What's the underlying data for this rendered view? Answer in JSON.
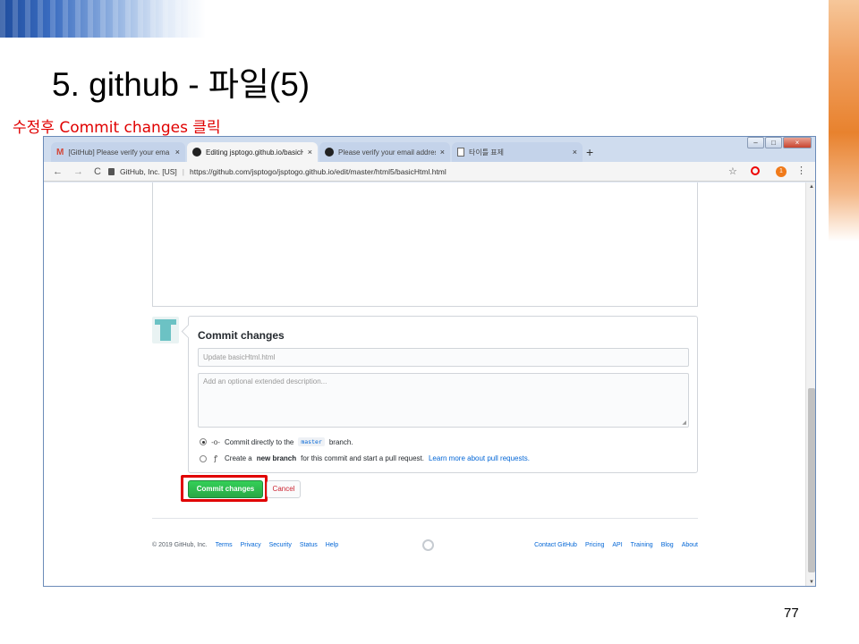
{
  "slide": {
    "title": "5. github - 파일(5)",
    "note": "수정후  Commit changes 클릭",
    "page_number": "77"
  },
  "browser": {
    "tabs": [
      {
        "label": "[GitHub] Please verify your ema",
        "icon": "gmail-icon",
        "active": false
      },
      {
        "label": "Editing jsptogo.github.io/basicH",
        "icon": "github-icon",
        "active": true
      },
      {
        "label": "Please verify your email address",
        "icon": "github-icon",
        "active": false
      },
      {
        "label": "타이틀 표제",
        "icon": "document-icon",
        "active": false
      }
    ],
    "tab_close": "×",
    "new_tab": "+",
    "window_controls": {
      "minimize": "–",
      "maximize": "□",
      "close": "×"
    },
    "nav": {
      "back": "←",
      "forward": "→",
      "reload": "C"
    },
    "site_identity": "GitHub, Inc. [US]",
    "url": "https://github.com/jsptogo/jsptogo.github.io/edit/master/html5/basicHtml.html",
    "profile_badge": "1"
  },
  "commit": {
    "heading": "Commit changes",
    "summary_placeholder": "Update basicHtml.html",
    "description_placeholder": "Add an optional extended description...",
    "option_direct": {
      "prefix": "Commit directly to the",
      "branch": "master",
      "suffix": "branch."
    },
    "option_new_branch": {
      "prefix": "Create a",
      "bold": "new branch",
      "middle": "for this commit and start a pull request.",
      "link": "Learn more about pull requests."
    },
    "commit_button": "Commit changes",
    "cancel_button": "Cancel"
  },
  "footer": {
    "copyright": "© 2019 GitHub, Inc.",
    "left_links": [
      "Terms",
      "Privacy",
      "Security",
      "Status",
      "Help"
    ],
    "right_links": [
      "Contact GitHub",
      "Pricing",
      "API",
      "Training",
      "Blog",
      "About"
    ]
  },
  "colors": {
    "commit_button": "#28a745",
    "cancel_text": "#cb2431",
    "highlight": "#e00000",
    "link": "#0366d6"
  }
}
